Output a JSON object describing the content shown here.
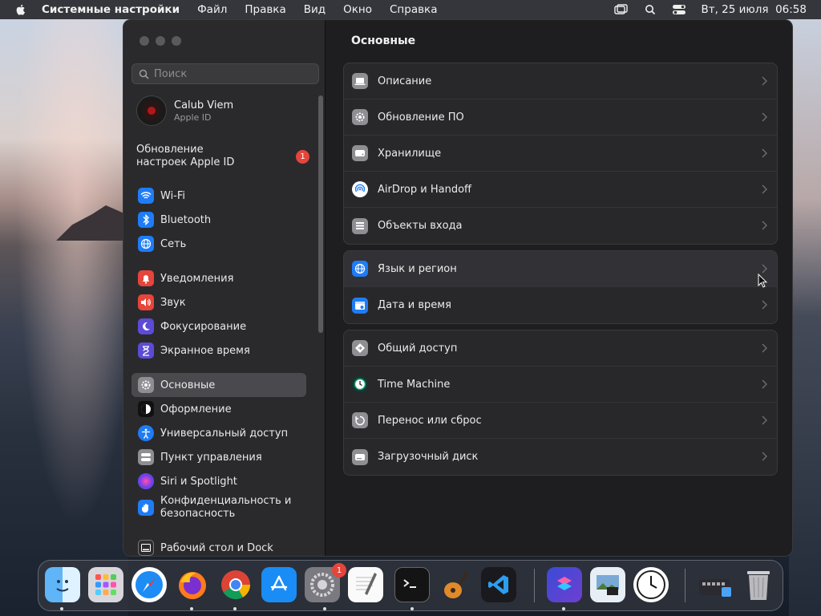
{
  "menubar": {
    "app_name": "Системные настройки",
    "menus": [
      "Файл",
      "Правка",
      "Вид",
      "Окно",
      "Справка"
    ],
    "datetime": "Вт, 25 июля  06:58"
  },
  "window": {
    "search_placeholder": "Поиск",
    "profile": {
      "name": "Calub Viem",
      "subtitle": "Apple ID"
    },
    "update": {
      "label": "Обновление настроек Apple ID",
      "badge": "1"
    },
    "sidebar": [
      {
        "label": "Wi-Fi",
        "icon": "wifi-icon",
        "color": "#1f7cf6"
      },
      {
        "label": "Bluetooth",
        "icon": "bluetooth-icon",
        "color": "#1f7cf6"
      },
      {
        "label": "Сеть",
        "icon": "globe-icon",
        "color": "#1f7cf6"
      },
      {
        "label": "Уведомления",
        "icon": "bell-icon",
        "color": "#e5453a"
      },
      {
        "label": "Звук",
        "icon": "speaker-icon",
        "color": "#e5453a"
      },
      {
        "label": "Фокусирование",
        "icon": "moon-icon",
        "color": "#5d4bd6"
      },
      {
        "label": "Экранное время",
        "icon": "hourglass-icon",
        "color": "#5d4bd6"
      },
      {
        "label": "Основные",
        "icon": "gear-icon",
        "color": "#8e8e93"
      },
      {
        "label": "Оформление",
        "icon": "appearance-icon",
        "color": "#1c1c1e"
      },
      {
        "label": "Универсальный доступ",
        "icon": "accessibility-icon",
        "color": "#1f7cf6"
      },
      {
        "label": "Пункт управления",
        "icon": "control-center-icon",
        "color": "#8e8e93"
      },
      {
        "label": "Siri и Spotlight",
        "icon": "siri-icon",
        "color": "#c54fc8"
      },
      {
        "label": "Конфиденциальность и безопасность",
        "icon": "hand-icon",
        "color": "#1f7cf6"
      },
      {
        "label": "Рабочий стол и Dock",
        "icon": "dock-icon",
        "color": "#2c2c2e"
      }
    ],
    "main_title": "Основные",
    "groups": [
      [
        {
          "label": "Описание",
          "icon": "laptop-icon"
        },
        {
          "label": "Обновление ПО",
          "icon": "gear-badge-icon"
        },
        {
          "label": "Хранилище",
          "icon": "drive-icon"
        },
        {
          "label": "AirDrop и Handoff",
          "icon": "airdrop-icon"
        },
        {
          "label": "Объекты входа",
          "icon": "list-icon"
        }
      ],
      [
        {
          "label": "Язык и регион",
          "icon": "globe-icon"
        },
        {
          "label": "Дата и время",
          "icon": "calendar-icon"
        }
      ],
      [
        {
          "label": "Общий доступ",
          "icon": "sharing-icon"
        },
        {
          "label": "Time Machine",
          "icon": "time-machine-icon"
        },
        {
          "label": "Перенос или сброс",
          "icon": "reset-icon"
        },
        {
          "label": "Загрузочный диск",
          "icon": "disk-icon"
        }
      ]
    ]
  },
  "dock": {
    "apps": [
      "Finder",
      "Launchpad",
      "Safari",
      "Firefox",
      "Chrome",
      "App Store",
      "Системные настройки",
      "TextEdit",
      "Терминал",
      "GarageBand",
      "Visual Studio Code",
      "Быстрые команды",
      "Просмотр",
      "Часы",
      "Загрузки",
      "Корзина"
    ],
    "settings_badge": "1"
  }
}
